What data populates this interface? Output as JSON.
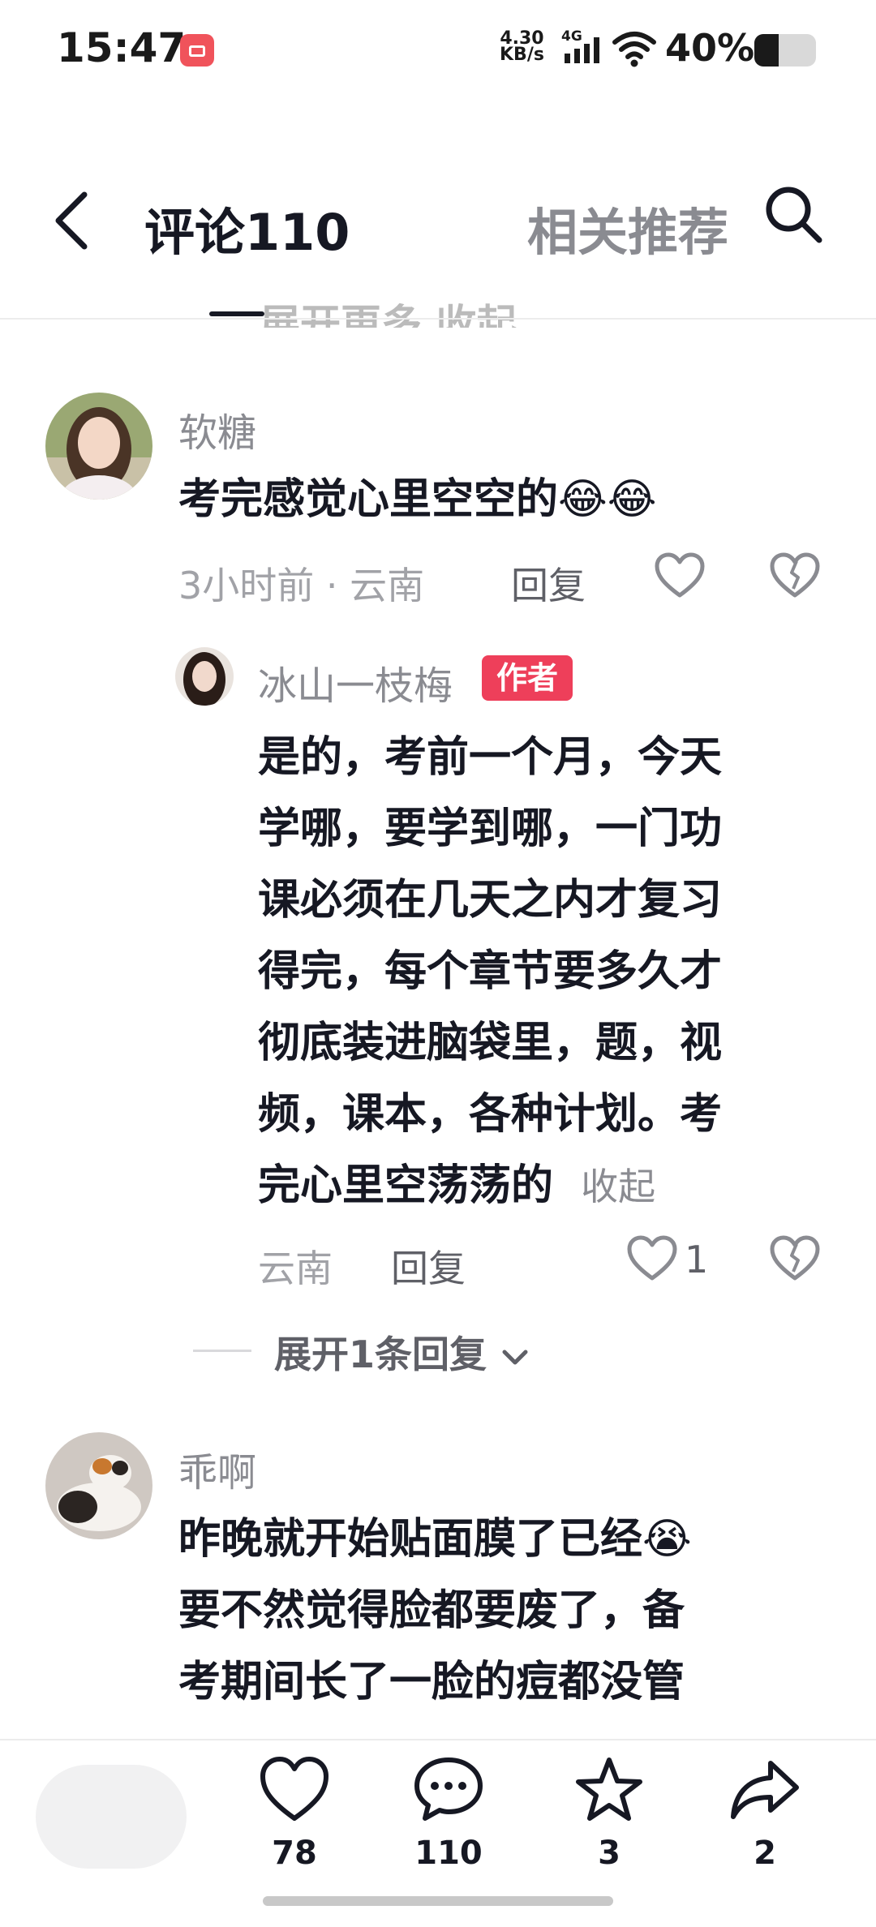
{
  "status_bar": {
    "time": "15:47",
    "net_speed_value": "4.30",
    "net_speed_unit": "KB/s",
    "network": "4G",
    "battery": "40%",
    "battery_level": 0.4
  },
  "header": {
    "tab_comments": "评论110",
    "tab_related": "相关推荐",
    "previous_hint": "展开更多  收起"
  },
  "comments": [
    {
      "user": "软糖",
      "text": "考完感觉心里空空的😂😂",
      "meta": "3小时前 · 云南",
      "reply_label": "回复",
      "replies": [
        {
          "user": "冰山一枝梅",
          "badge": "作者",
          "lines": [
            "是的，考前一个月，今天",
            "学哪，要学到哪，一门功",
            "课必须在几天之内才复习",
            "得完，每个章节要多久才",
            "彻底装进脑袋里，题，视",
            "频，课本，各种计划。考",
            "完心里空荡荡的"
          ],
          "collapse_label": "收起",
          "meta": "云南",
          "reply_label": "回复",
          "likes": "1"
        }
      ],
      "expand_label": "展开1条回复"
    },
    {
      "user": "乖啊",
      "lines": [
        "昨晚就开始贴面膜了已经😭",
        "要不然觉得脸都要废了，备",
        "考期间长了一脸的痘都没管"
      ]
    }
  ],
  "bottom_bar": {
    "likes": "78",
    "comments": "110",
    "favorites": "3",
    "shares": "2"
  },
  "colors": {
    "author_badge": "#ee3f5a",
    "primary_text": "#161823",
    "secondary_text": "#8a8b91"
  }
}
